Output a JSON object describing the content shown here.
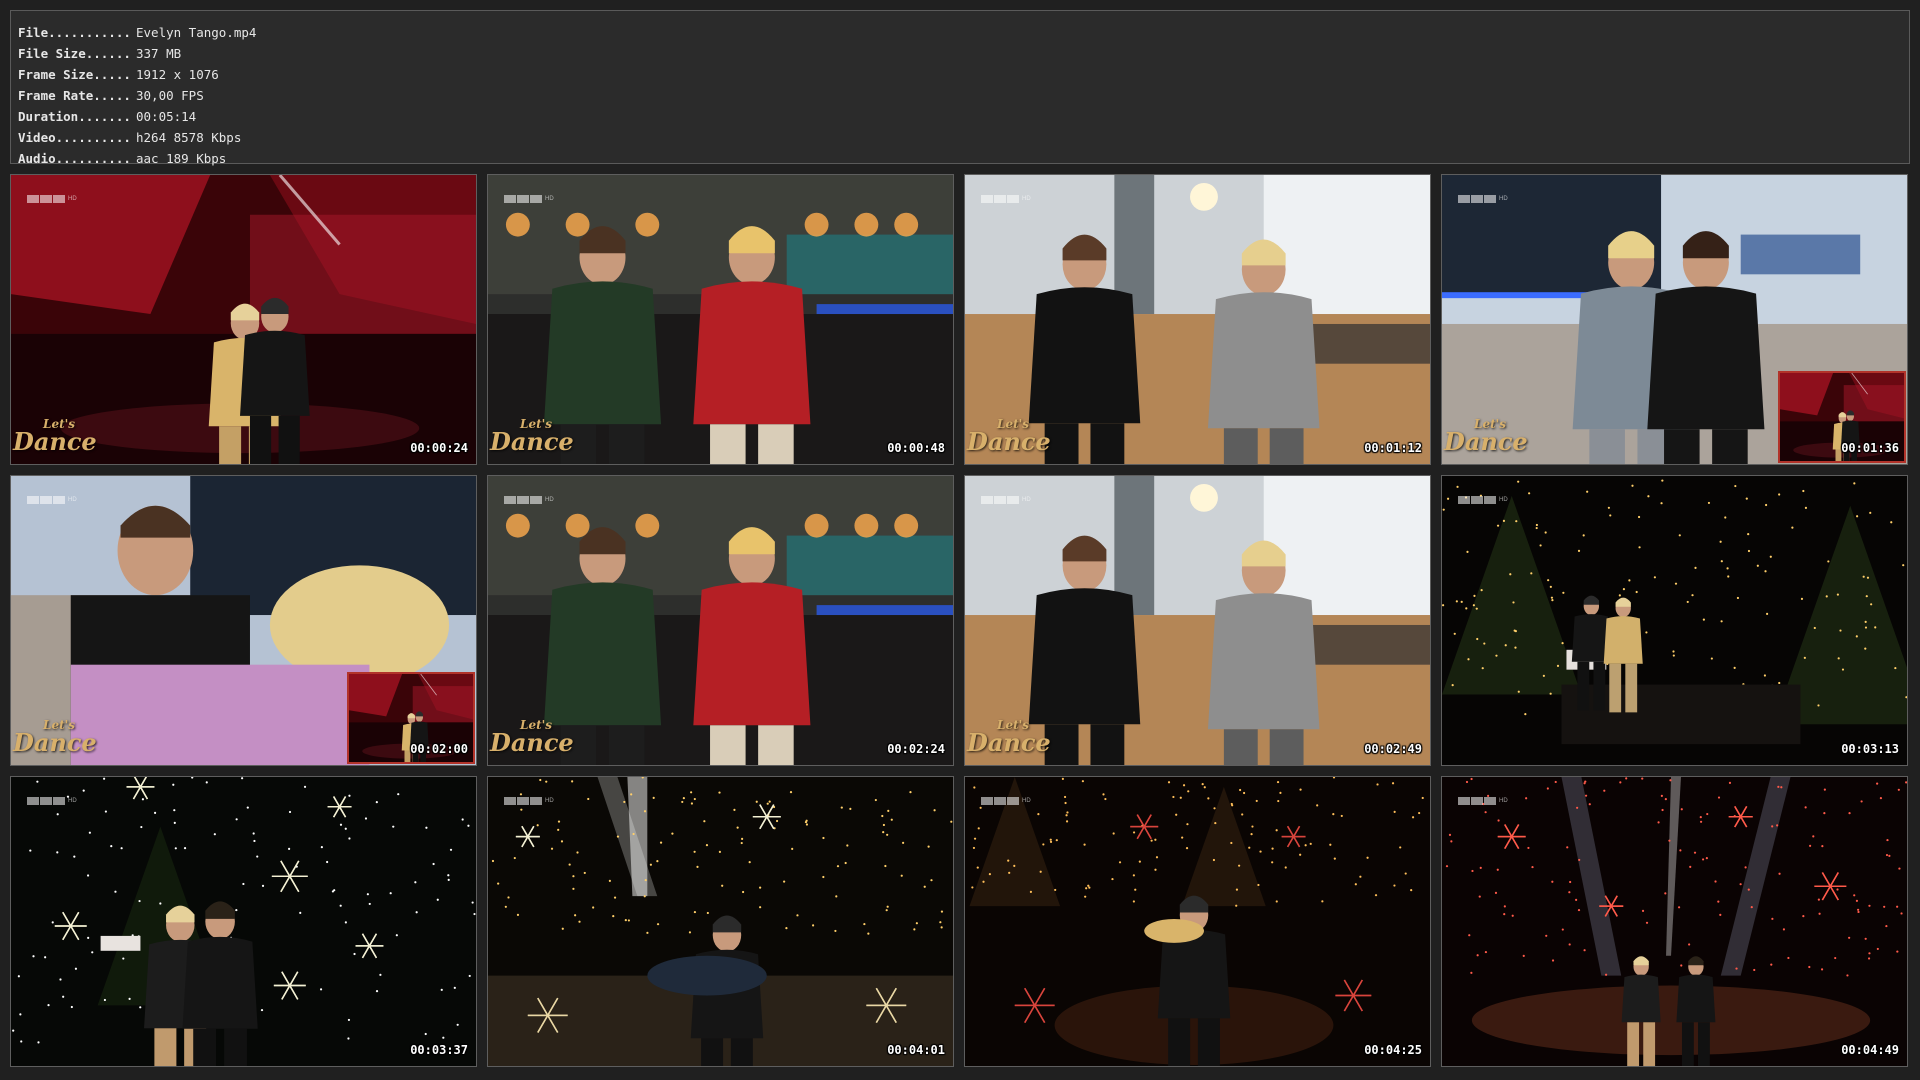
{
  "info": [
    {
      "key": "File...........",
      "value": "Evelyn Tango.mp4"
    },
    {
      "key": "File Size......",
      "value": "337 MB"
    },
    {
      "key": "Frame Size.....",
      "value": "1912 x 1076"
    },
    {
      "key": "Frame Rate.....",
      "value": "30,00 FPS"
    },
    {
      "key": "Duration.......",
      "value": "00:05:14"
    },
    {
      "key": "Video..........",
      "value": "h264 8578 Kbps"
    },
    {
      "key": "Audio..........",
      "value": "aac 189 Kbps"
    }
  ],
  "broadcaster_logo": {
    "letters": [
      "R",
      "T",
      "L"
    ],
    "suffix": "HD"
  },
  "show_logo": {
    "line1": "Let's",
    "line2": "Dance"
  },
  "thumbnails": [
    {
      "time": "00:00:24",
      "scene": "stage-red",
      "show_logo": true,
      "pip": false
    },
    {
      "time": "00:00:48",
      "scene": "interview",
      "show_logo": true,
      "pip": false
    },
    {
      "time": "00:01:12",
      "scene": "studio-bright",
      "show_logo": true,
      "pip": false
    },
    {
      "time": "00:01:36",
      "scene": "studio-blue",
      "show_logo": true,
      "pip": true
    },
    {
      "time": "00:02:00",
      "scene": "studio-closeup",
      "show_logo": true,
      "pip": true
    },
    {
      "time": "00:02:24",
      "scene": "interview",
      "show_logo": true,
      "pip": false
    },
    {
      "time": "00:02:49",
      "scene": "studio-bright",
      "show_logo": true,
      "pip": false
    },
    {
      "time": "00:03:13",
      "scene": "stage-dark",
      "show_logo": false,
      "pip": false
    },
    {
      "time": "00:03:37",
      "scene": "stage-stars",
      "show_logo": false,
      "pip": false
    },
    {
      "time": "00:04:01",
      "scene": "stage-spot",
      "show_logo": false,
      "pip": false
    },
    {
      "time": "00:04:25",
      "scene": "stage-trees",
      "show_logo": false,
      "pip": false
    },
    {
      "time": "00:04:49",
      "scene": "stage-beams",
      "show_logo": false,
      "pip": false
    }
  ],
  "colors": {
    "background": "#202020",
    "panel": "#2b2b2b",
    "panel_border": "#5a5a5a",
    "text": "#e6e6e6",
    "timestamp": "#ffffff",
    "logo_gold": "#d8b06b"
  }
}
